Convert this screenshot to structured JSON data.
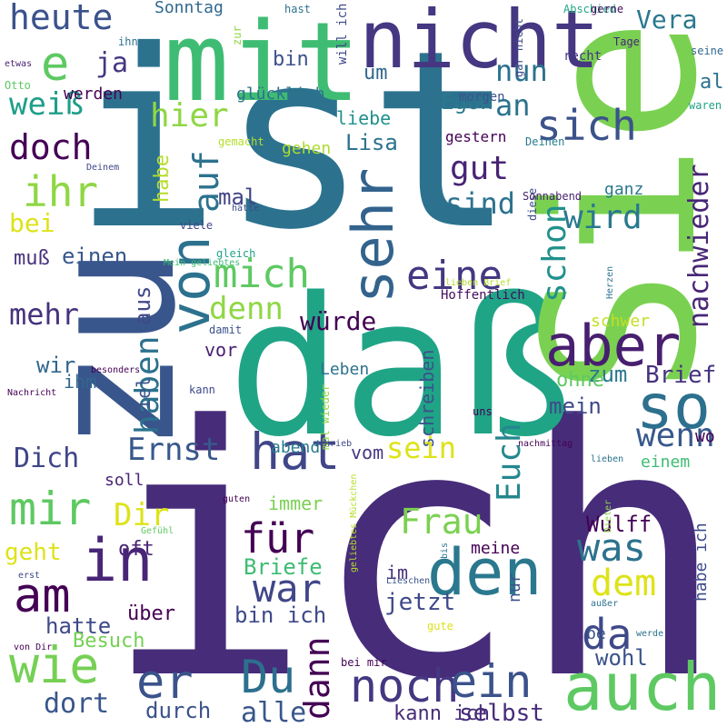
{
  "words": [
    {
      "text": "ich",
      "color": "#472c7a",
      "vertical": false
    },
    {
      "text": "ist",
      "color": "#2c728e",
      "vertical": false
    },
    {
      "text": "daß",
      "color": "#20a486",
      "vertical": false
    },
    {
      "text": "Sie",
      "color": "#7ad151",
      "vertical": true
    },
    {
      "text": "zu",
      "color": "#39568c",
      "vertical": true
    },
    {
      "text": "mit",
      "color": "#3fbc73",
      "vertical": false
    },
    {
      "text": "nicht",
      "color": "#453781",
      "vertical": false
    },
    {
      "text": "auch",
      "color": "#5ec962",
      "vertical": false
    },
    {
      "text": "den",
      "color": "#2a788e",
      "vertical": false
    },
    {
      "text": "so",
      "color": "#2d708e",
      "vertical": false
    },
    {
      "text": "aber",
      "color": "#481f70",
      "vertical": false
    },
    {
      "text": "sehr",
      "color": "#33638d",
      "vertical": true
    },
    {
      "text": "von",
      "color": "#2c728e",
      "vertical": true
    },
    {
      "text": "hat",
      "color": "#404688",
      "vertical": false
    },
    {
      "text": "mir",
      "color": "#5ec962",
      "vertical": false
    },
    {
      "text": "in",
      "color": "#482576",
      "vertical": false
    },
    {
      "text": "am",
      "color": "#440154",
      "vertical": false
    },
    {
      "text": "wie",
      "color": "#75d054",
      "vertical": false
    },
    {
      "text": "er",
      "color": "#3b528b",
      "vertical": false
    },
    {
      "text": "Du",
      "color": "#2d708e",
      "vertical": false
    },
    {
      "text": "noch",
      "color": "#453781",
      "vertical": false
    },
    {
      "text": "ein",
      "color": "#3b528b",
      "vertical": false
    },
    {
      "text": "dann",
      "color": "#440154",
      "vertical": true
    },
    {
      "text": "für",
      "color": "#440154",
      "vertical": false
    },
    {
      "text": "war",
      "color": "#404688",
      "vertical": false
    },
    {
      "text": "da",
      "color": "#3e4989",
      "vertical": false
    },
    {
      "text": "was",
      "color": "#2c728e",
      "vertical": false
    },
    {
      "text": "dem",
      "color": "#dde318",
      "vertical": false
    },
    {
      "text": "Frau",
      "color": "#7ad151",
      "vertical": false
    },
    {
      "text": "Euch",
      "color": "#24878e",
      "vertical": true
    },
    {
      "text": "mich",
      "color": "#5ec962",
      "vertical": false
    },
    {
      "text": "eine",
      "color": "#453781",
      "vertical": false
    },
    {
      "text": "auf",
      "color": "#2c728e",
      "vertical": true
    },
    {
      "text": "haben",
      "color": "#2c728e",
      "vertical": true
    },
    {
      "text": "schon",
      "color": "#21918c",
      "vertical": true
    },
    {
      "text": "nachwieder",
      "color": "#482677",
      "vertical": true
    },
    {
      "text": "wenn",
      "color": "#38588c",
      "vertical": false
    },
    {
      "text": "Ernst",
      "color": "#38588c",
      "vertical": false
    },
    {
      "text": "denn",
      "color": "#8fd744",
      "vertical": false
    },
    {
      "text": "würde",
      "color": "#440154",
      "vertical": false
    },
    {
      "text": "heute",
      "color": "#3b528b",
      "vertical": false
    },
    {
      "text": "e",
      "color": "#5ec962",
      "vertical": false
    },
    {
      "text": "ja",
      "color": "#453781",
      "vertical": false
    },
    {
      "text": "weiß",
      "color": "#1f9e89",
      "vertical": false
    },
    {
      "text": "doch",
      "color": "#440154",
      "vertical": false
    },
    {
      "text": "ihr",
      "color": "#8fd744",
      "vertical": false
    },
    {
      "text": "bei",
      "color": "#dde318",
      "vertical": false
    },
    {
      "text": "muß",
      "color": "#46327e",
      "vertical": false
    },
    {
      "text": "einen",
      "color": "#38588c",
      "vertical": false
    },
    {
      "text": "mehr",
      "color": "#46327e",
      "vertical": false
    },
    {
      "text": "wir",
      "color": "#31688e",
      "vertical": false
    },
    {
      "text": "ihm",
      "color": "#31688e",
      "vertical": false
    },
    {
      "text": "Dich",
      "color": "#404688",
      "vertical": false
    },
    {
      "text": "Dir",
      "color": "#dde318",
      "vertical": false
    },
    {
      "text": "geht",
      "color": "#dde318",
      "vertical": false
    },
    {
      "text": "Sonntag",
      "color": "#31688e",
      "vertical": false
    },
    {
      "text": "bin",
      "color": "#3b528b",
      "vertical": false
    },
    {
      "text": "um",
      "color": "#31688e",
      "vertical": false
    },
    {
      "text": "nun",
      "color": "#2c728e",
      "vertical": false
    },
    {
      "text": "Egon",
      "color": "#2a788e",
      "vertical": false
    },
    {
      "text": "hier",
      "color": "#8fd744",
      "vertical": false
    },
    {
      "text": "liebe",
      "color": "#21918c",
      "vertical": false
    },
    {
      "text": "glücklich",
      "color": "#2c728e",
      "vertical": false
    },
    {
      "text": "werden",
      "color": "#440154",
      "vertical": false
    },
    {
      "text": "an",
      "color": "#2c728e",
      "vertical": false
    },
    {
      "text": "sich",
      "color": "#3b528b",
      "vertical": false
    },
    {
      "text": "Lisa",
      "color": "#2c728e",
      "vertical": false
    },
    {
      "text": "gut",
      "color": "#482475",
      "vertical": false
    },
    {
      "text": "sind",
      "color": "#2c728e",
      "vertical": false
    },
    {
      "text": "wird",
      "color": "#2a788e",
      "vertical": false
    },
    {
      "text": "Vera",
      "color": "#2a788e",
      "vertical": false
    },
    {
      "text": "mal",
      "color": "#414487",
      "vertical": false
    },
    {
      "text": "habe",
      "color": "#b5de2b",
      "vertical": true
    },
    {
      "text": "gehen",
      "color": "#addc30",
      "vertical": false
    },
    {
      "text": "gestern",
      "color": "#440154",
      "vertical": false
    },
    {
      "text": "ganz",
      "color": "#2a788e",
      "vertical": false
    },
    {
      "text": "aus",
      "color": "#3e4989",
      "vertical": true
    },
    {
      "text": "viel",
      "color": "#3b528b",
      "vertical": true
    },
    {
      "text": "vor",
      "color": "#481f70",
      "vertical": false
    },
    {
      "text": "zum",
      "color": "#2a788e",
      "vertical": false
    },
    {
      "text": "Brief",
      "color": "#46327e",
      "vertical": false
    },
    {
      "text": "ohne",
      "color": "#5ec962",
      "vertical": false
    },
    {
      "text": "mein",
      "color": "#3e4989",
      "vertical": false
    },
    {
      "text": "schreiben",
      "color": "#3b528b",
      "vertical": true
    },
    {
      "text": "sein",
      "color": "#dde318",
      "vertical": false
    },
    {
      "text": "vom",
      "color": "#453781",
      "vertical": false
    },
    {
      "text": "Leben",
      "color": "#2c728e",
      "vertical": false
    },
    {
      "text": "abend",
      "color": "#287c8e",
      "vertical": false
    },
    {
      "text": "soll",
      "color": "#482576",
      "vertical": false
    },
    {
      "text": "immer",
      "color": "#7ad151",
      "vertical": false
    },
    {
      "text": "Wulff",
      "color": "#440154",
      "vertical": false
    },
    {
      "text": "oft",
      "color": "#482576",
      "vertical": false
    },
    {
      "text": "meine",
      "color": "#440154",
      "vertical": false
    },
    {
      "text": "im",
      "color": "#46327e",
      "vertical": false
    },
    {
      "text": "jetzt",
      "color": "#3e4989",
      "vertical": false
    },
    {
      "text": "nur",
      "color": "#3b528b",
      "vertical": true
    },
    {
      "text": "habe ich",
      "color": "#3e4989",
      "vertical": true
    },
    {
      "text": "wohl",
      "color": "#3b528b",
      "vertical": false
    },
    {
      "text": "hatte",
      "color": "#3e4989",
      "vertical": false
    },
    {
      "text": "über",
      "color": "#440154",
      "vertical": false
    },
    {
      "text": "Besuch",
      "color": "#75d054",
      "vertical": false
    },
    {
      "text": "Briefe",
      "color": "#3fbc73",
      "vertical": false
    },
    {
      "text": "bin ich",
      "color": "#3e4989",
      "vertical": false
    },
    {
      "text": "dort",
      "color": "#39568c",
      "vertical": false
    },
    {
      "text": "durch",
      "color": "#3b528b",
      "vertical": false
    },
    {
      "text": "alle",
      "color": "#39568c",
      "vertical": false
    },
    {
      "text": "selbst",
      "color": "#472c7a",
      "vertical": false
    },
    {
      "text": "kann ich",
      "color": "#472c7a",
      "vertical": false
    },
    {
      "text": "be",
      "color": "#3b528b",
      "vertical": false
    },
    {
      "text": "schwer",
      "color": "#c2df23",
      "vertical": false
    },
    {
      "text": "wo",
      "color": "#440154",
      "vertical": false
    },
    {
      "text": "einem",
      "color": "#3fbc73",
      "vertical": false
    },
    {
      "text": "al",
      "color": "#2c728e",
      "vertical": false
    },
    {
      "text": "Hoffentlich",
      "color": "#460b5e",
      "vertical": false
    },
    {
      "text": "morgen",
      "color": "#3b528b",
      "vertical": false
    },
    {
      "text": "waren",
      "color": "#1fa187",
      "vertical": false
    },
    {
      "text": "seine",
      "color": "#31688e",
      "vertical": false
    },
    {
      "text": "Tage",
      "color": "#482576",
      "vertical": false
    },
    {
      "text": "recht",
      "color": "#453781",
      "vertical": false
    },
    {
      "text": "Abschied",
      "color": "#22a884",
      "vertical": false
    },
    {
      "text": "gerne",
      "color": "#460b5e",
      "vertical": false
    },
    {
      "text": "hast",
      "color": "#2c728e",
      "vertical": false
    },
    {
      "text": "will ich",
      "color": "#3e4989",
      "vertical": true
    },
    {
      "text": "zur",
      "color": "#8fd744",
      "vertical": true
    },
    {
      "text": "gar nicht",
      "color": "#3e4989",
      "vertical": true
    },
    {
      "text": "Deinen",
      "color": "#287c8e",
      "vertical": false
    },
    {
      "text": "diese",
      "color": "#3e4989",
      "vertical": true
    },
    {
      "text": "gemacht",
      "color": "#b5de2b",
      "vertical": false
    },
    {
      "text": "Sonnabend",
      "color": "#481f70",
      "vertical": false
    },
    {
      "text": "etwas",
      "color": "#481f70",
      "vertical": false
    },
    {
      "text": "ihn",
      "color": "#2c728e",
      "vertical": false
    },
    {
      "text": "Otto",
      "color": "#5ec962",
      "vertical": false
    },
    {
      "text": "Deinem",
      "color": "#404688",
      "vertical": false
    },
    {
      "text": "hätte",
      "color": "#3e4989",
      "vertical": false
    },
    {
      "text": "viele",
      "color": "#404688",
      "vertical": false
    },
    {
      "text": "gleich",
      "color": "#20a486",
      "vertical": false
    },
    {
      "text": "Mein geliebtes",
      "color": "#3fbc73",
      "vertical": false
    },
    {
      "text": "lieben Brief",
      "color": "#b5de2b",
      "vertical": false
    },
    {
      "text": "Herzen",
      "color": "#2c728e",
      "vertical": true
    },
    {
      "text": "damit",
      "color": "#3b528b",
      "vertical": false
    },
    {
      "text": "besonders",
      "color": "#440154",
      "vertical": false
    },
    {
      "text": "kann",
      "color": "#3e4989",
      "vertical": false
    },
    {
      "text": "mal wieder",
      "color": "#8fd744",
      "vertical": true
    },
    {
      "text": "Nachricht",
      "color": "#440154",
      "vertical": false
    },
    {
      "text": "schrieb",
      "color": "#3e4989",
      "vertical": false
    },
    {
      "text": "uns",
      "color": "#440154",
      "vertical": false
    },
    {
      "text": "geliebtes Mückchen",
      "color": "#b5de2b",
      "vertical": true
    },
    {
      "text": "nachmittag",
      "color": "#440154",
      "vertical": false
    },
    {
      "text": "lieben",
      "color": "#2c728e",
      "vertical": false
    },
    {
      "text": "guten",
      "color": "#440154",
      "vertical": false
    },
    {
      "text": "Dieter",
      "color": "#8fd744",
      "vertical": true
    },
    {
      "text": "Gefühl",
      "color": "#5ec962",
      "vertical": false
    },
    {
      "text": "erst",
      "color": "#3e4989",
      "vertical": false
    },
    {
      "text": "bis",
      "color": "#2c728e",
      "vertical": true
    },
    {
      "text": "Lieschen",
      "color": "#3b528b",
      "vertical": false
    },
    {
      "text": "außer",
      "color": "#2c728e",
      "vertical": false
    },
    {
      "text": "gute",
      "color": "#dde318",
      "vertical": false
    },
    {
      "text": "werde",
      "color": "#2c728e",
      "vertical": false
    },
    {
      "text": "von Dir",
      "color": "#440154",
      "vertical": false
    },
    {
      "text": "bei mir",
      "color": "#440154",
      "vertical": false
    }
  ]
}
